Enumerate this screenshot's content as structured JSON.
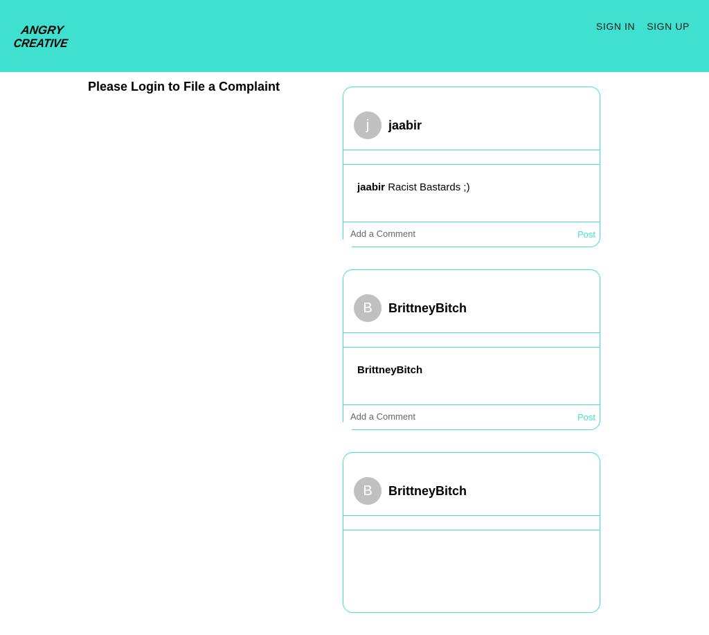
{
  "brand": {
    "logo_text_line1": "ANGRY",
    "logo_text_line2": "CREATIVE",
    "accent_color": "#40e0d0"
  },
  "nav": {
    "sign_in": "SIGN IN",
    "sign_up": "SIGN UP"
  },
  "main": {
    "login_message": "Please Login to File a Complaint"
  },
  "posts": [
    {
      "avatar_letter": "j",
      "username": "jaabir",
      "caption_user": "jaabir",
      "caption_text": "Racist Bastards ;)",
      "comment_placeholder": "Add a Comment",
      "post_label": "Post"
    },
    {
      "avatar_letter": "B",
      "username": "BrittneyBitch",
      "caption_user": "BrittneyBitch",
      "caption_text": "",
      "comment_placeholder": "Add a Comment",
      "post_label": "Post"
    },
    {
      "avatar_letter": "B",
      "username": "BrittneyBitch",
      "caption_user": "",
      "caption_text": "",
      "comment_placeholder": "",
      "post_label": ""
    }
  ]
}
